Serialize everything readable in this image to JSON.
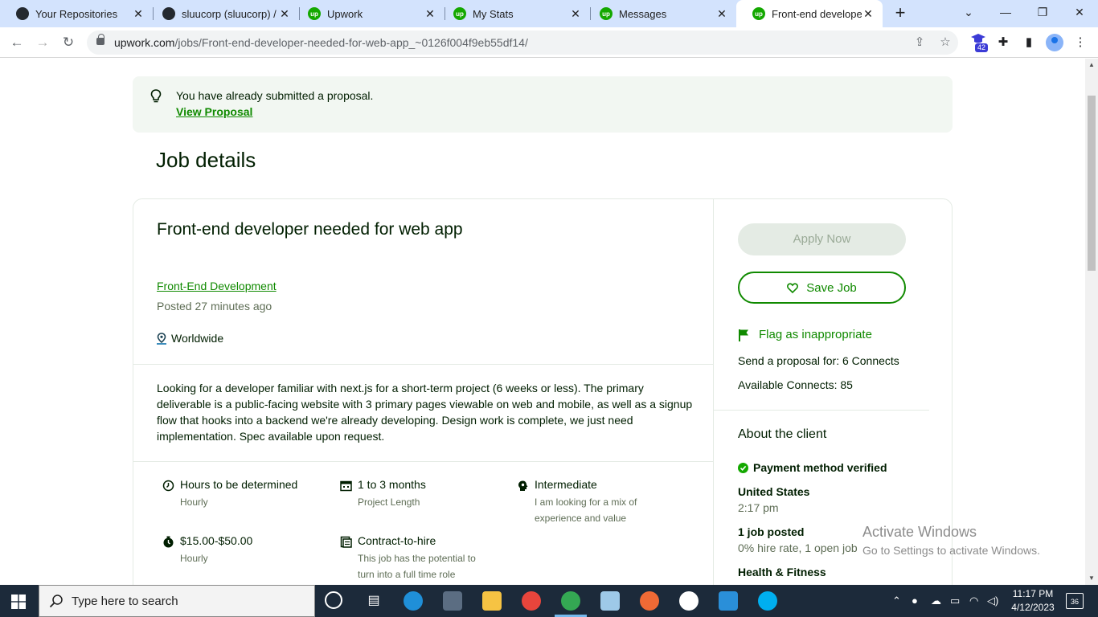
{
  "browser": {
    "tabs": [
      {
        "title": "Your Repositories",
        "favicon": "github-icon"
      },
      {
        "title": "sluucorp (sluucorp) / F",
        "favicon": "github-icon"
      },
      {
        "title": "Upwork",
        "favicon": "upwork-icon"
      },
      {
        "title": "My Stats",
        "favicon": "upwork-icon"
      },
      {
        "title": "Messages",
        "favicon": "upwork-icon"
      },
      {
        "title": "Front-end developer n",
        "favicon": "upwork-icon"
      }
    ],
    "url_host": "upwork.com",
    "url_path": "/jobs/Front-end-developer-needed-for-web-app_~0126f004f9eb55df14/",
    "extension_badge": "42"
  },
  "notice": {
    "message": "You have already submitted a proposal.",
    "link": "View Proposal"
  },
  "page_title": "Job details",
  "job": {
    "title": "Front-end developer needed for web app",
    "category": "Front-End Development",
    "posted": "Posted 27 minutes ago",
    "location": "Worldwide",
    "description": "Looking for a developer familiar with next.js for a short-term project (6 weeks or less). The primary deliverable is a public-facing website with 3 primary pages viewable on web and mobile, as well as a signup flow that hooks into a backend we're already developing. Design work is complete, we just need implementation. Spec available upon request.",
    "features": [
      {
        "title": "Hours to be determined",
        "subtitle": "Hourly",
        "icon": "clock-icon"
      },
      {
        "title": "1 to 3 months",
        "subtitle": "Project Length",
        "icon": "calendar-icon"
      },
      {
        "title": "Intermediate",
        "subtitle": "I am looking for a mix of experience and value",
        "icon": "brain-icon"
      },
      {
        "title": "$15.00-$50.00",
        "subtitle": "Hourly",
        "icon": "timer-icon"
      },
      {
        "title": "Contract-to-hire",
        "subtitle": "This job has the potential to turn into a full time role",
        "icon": "contract-icon"
      }
    ]
  },
  "sidebar": {
    "apply_label": "Apply Now",
    "save_label": "Save Job",
    "flag_label": "Flag as inappropriate",
    "connects_cost": "Send a proposal for: 6 Connects",
    "available_connects": "Available Connects: 85"
  },
  "client": {
    "heading": "About the client",
    "payment": "Payment method verified",
    "country": "United States",
    "local_time": "2:17 pm",
    "jobs_posted": "1 job posted",
    "hire_rate": "0% hire rate, 1 open job",
    "industry": "Health & Fitness"
  },
  "watermark": {
    "line1": "Activate Windows",
    "line2": "Go to Settings to activate Windows."
  },
  "taskbar": {
    "search_placeholder": "Type here to search",
    "time": "11:17 PM",
    "date": "4/12/2023",
    "notification_count": "36"
  },
  "colors": {
    "upwork_green": "#108a00",
    "tab_bar": "#d3e3fd",
    "taskbar": "#1c2a3a"
  }
}
